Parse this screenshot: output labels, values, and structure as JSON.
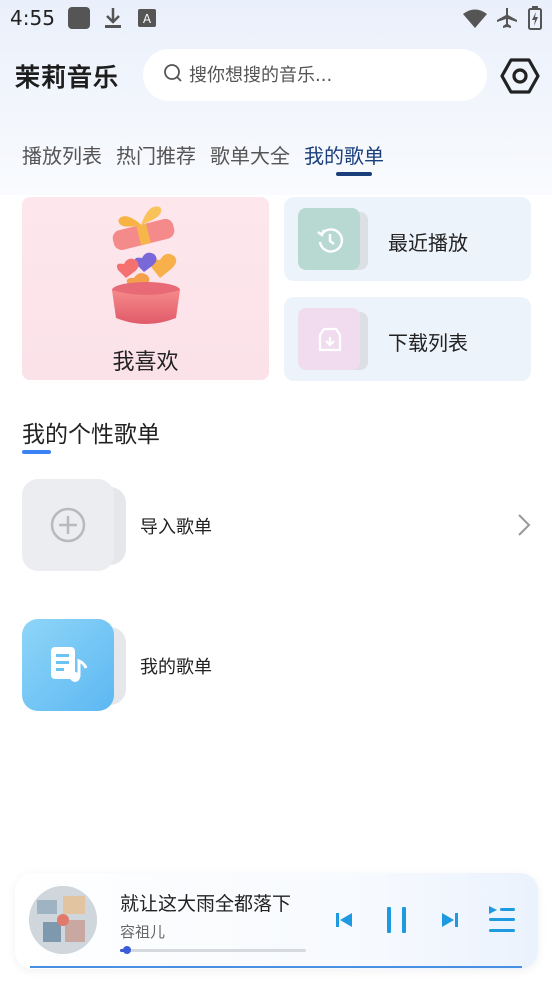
{
  "status_bar": {
    "time": "4:55",
    "icons": [
      "app-square-icon",
      "download-icon",
      "a-font-icon",
      "wifi-icon",
      "airplane-icon",
      "battery-icon"
    ]
  },
  "header": {
    "title": "茉莉音乐",
    "search_placeholder": "搜你想搜的音乐...",
    "settings_icon": "hexagon-settings-icon"
  },
  "tabs": [
    {
      "label": "播放列表",
      "active": false
    },
    {
      "label": "热门推荐",
      "active": false
    },
    {
      "label": "歌单大全",
      "active": false
    },
    {
      "label": "我的歌单",
      "active": true
    }
  ],
  "cards": {
    "favorites": {
      "label": "我喜欢",
      "icon": "gift-box-hearts-icon"
    },
    "recent": {
      "label": "最近播放",
      "icon": "clock-history-icon"
    },
    "downloads": {
      "label": "下载列表",
      "icon": "download-box-icon"
    }
  },
  "section": {
    "title": "我的个性歌单"
  },
  "playlists": [
    {
      "label": "导入歌单",
      "icon": "plus-circle-icon"
    },
    {
      "label": "我的歌单",
      "icon": "music-note-doc-icon"
    }
  ],
  "player": {
    "title": "就让这大雨全都落下",
    "artist": "容祖儿",
    "progress": 0.04
  },
  "colors": {
    "accent": "#1a3f7a",
    "player_controls": "#1e9be0",
    "section_bar": "#3b82f6"
  }
}
